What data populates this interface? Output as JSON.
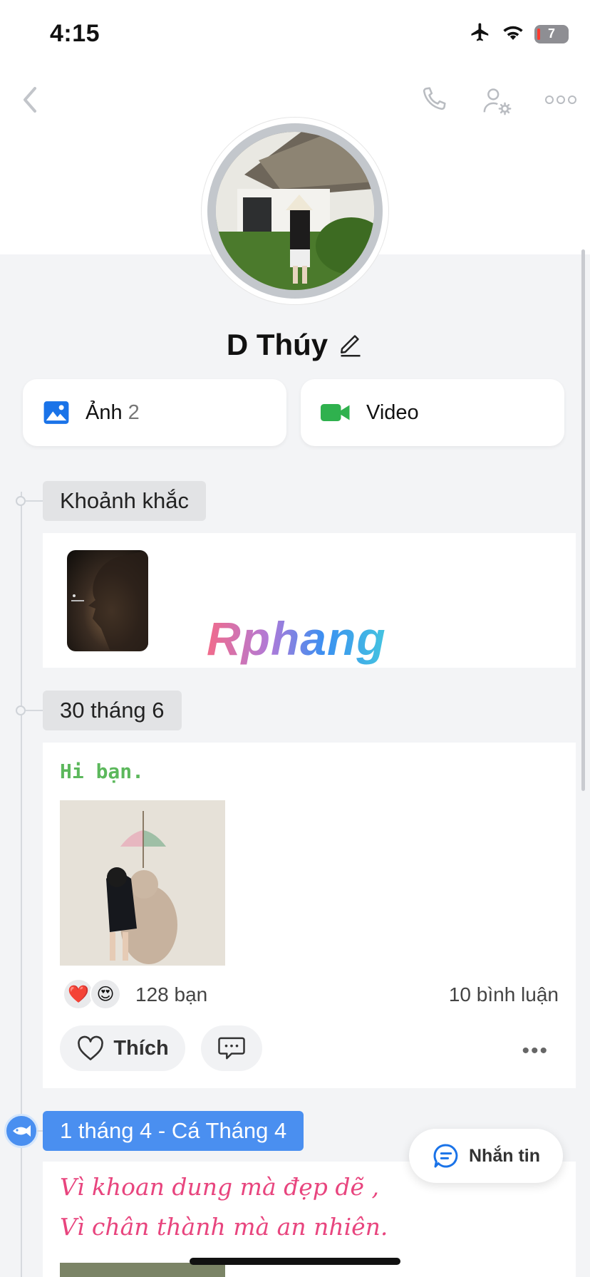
{
  "status_bar": {
    "time": "4:15",
    "battery": "7"
  },
  "profile": {
    "name": "D Thúy"
  },
  "media_tabs": [
    {
      "label": "Ảnh",
      "count": "2"
    },
    {
      "label": "Video"
    }
  ],
  "moments": {
    "label": "Khoảnh khắc",
    "watermark": "Rphang"
  },
  "post1": {
    "date": "30 tháng 6",
    "text": "Hi bạn.",
    "reactions": [
      "❤️",
      "😍"
    ],
    "likes": "128 bạn",
    "comments": "10 bình luận",
    "like_label": "Thích",
    "more": "•••"
  },
  "post2": {
    "date": "1 tháng 4 - Cá Tháng 4",
    "line1": "Vì khoan dung mà đẹp dẽ ,",
    "line2": "Vì chân thành mà an nhiên."
  },
  "message_button": {
    "label": "Nhắn tin"
  },
  "colors": {
    "accent": "#4a8ff0",
    "post_text": "#5cb85c",
    "quote": "#e8457e",
    "video_icon": "#2fb14e"
  }
}
